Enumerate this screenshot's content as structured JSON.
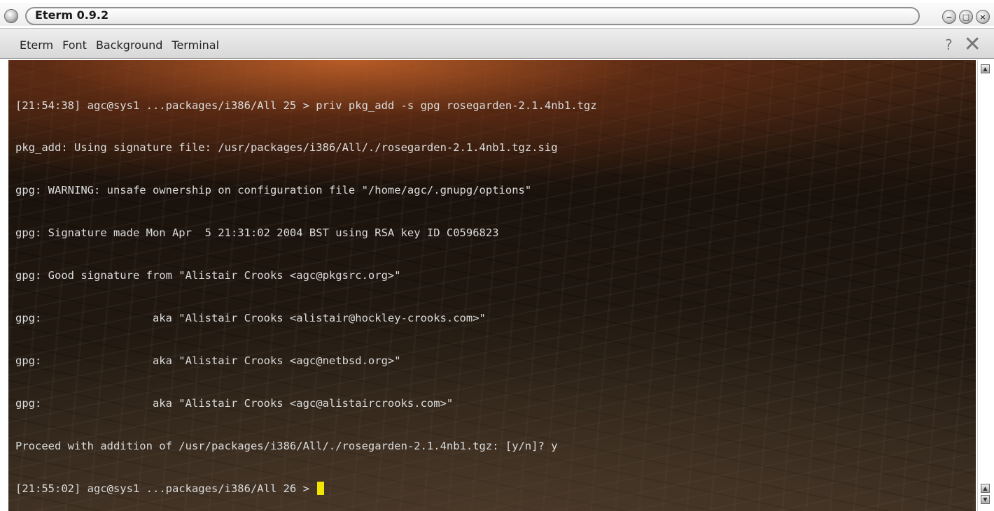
{
  "window": {
    "title": "Eterm 0.9.2",
    "controls": [
      {
        "name": "minimize-button",
        "glyph": "‒"
      },
      {
        "name": "maximize-button",
        "glyph": "□"
      },
      {
        "name": "close-button",
        "glyph": "×"
      }
    ]
  },
  "menubar": {
    "items": [
      {
        "label": "Eterm"
      },
      {
        "label": "Font"
      },
      {
        "label": "Background"
      },
      {
        "label": "Terminal"
      }
    ],
    "help_glyph": "?",
    "close_glyph": "✕"
  },
  "terminal": {
    "lines": [
      "[21:54:38] agc@sys1 ...packages/i386/All 25 > priv pkg_add -s gpg rosegarden-2.1.4nb1.tgz",
      "pkg_add: Using signature file: /usr/packages/i386/All/./rosegarden-2.1.4nb1.tgz.sig",
      "gpg: WARNING: unsafe ownership on configuration file \"/home/agc/.gnupg/options\"",
      "gpg: Signature made Mon Apr  5 21:31:02 2004 BST using RSA key ID C0596823",
      "gpg: Good signature from \"Alistair Crooks <agc@pkgsrc.org>\"",
      "gpg:                 aka \"Alistair Crooks <alistair@hockley-crooks.com>\"",
      "gpg:                 aka \"Alistair Crooks <agc@netbsd.org>\"",
      "gpg:                 aka \"Alistair Crooks <agc@alistaircrooks.com>\"",
      "Proceed with addition of /usr/packages/i386/All/./rosegarden-2.1.4nb1.tgz: [y/n]? y"
    ],
    "prompt": "[21:55:02] agc@sys1 ...packages/i386/All 26 > ",
    "text_color": "#dcdcdc",
    "cursor_color": "#f2e600"
  },
  "scrollbar": {
    "up_glyph": "▲",
    "down_glyph": "▼"
  }
}
